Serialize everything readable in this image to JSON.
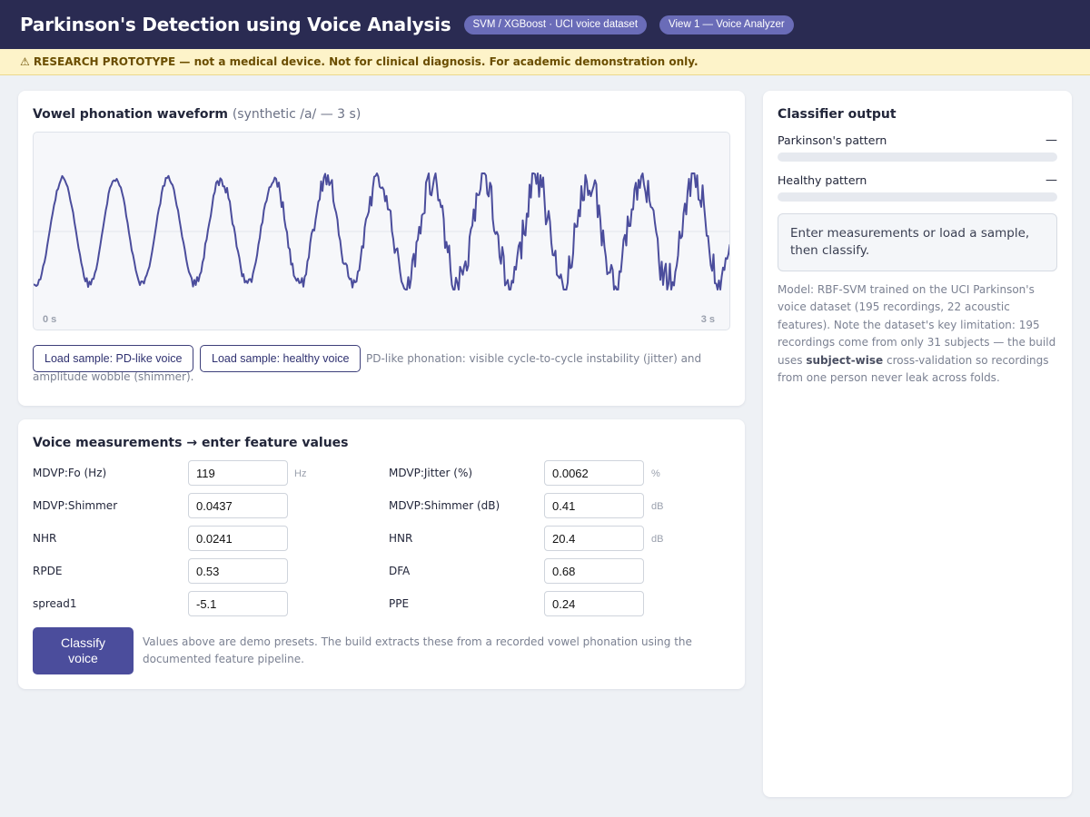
{
  "header": {
    "title": "Parkinson's Detection using Voice Analysis",
    "badges": [
      "SVM / XGBoost · UCI voice dataset",
      "View 1 — Voice Analyzer"
    ]
  },
  "disclaimer": "⚠ RESEARCH PROTOTYPE — not a medical device. Not for clinical diagnosis. For academic demonstration only.",
  "waveform": {
    "title": "Vowel phonation waveform",
    "subtitle": "(synthetic /a/ — 3 s)",
    "axis_start": "0 s",
    "axis_end": "3 s",
    "line_color": "#4b4d9c",
    "buttons": {
      "pd_sample": "Load sample: PD-like voice",
      "healthy_sample": "Load sample: healthy voice"
    },
    "note": "PD-like phonation: visible cycle-to-cycle instability (jitter) and amplitude wobble (shimmer)."
  },
  "measurements": {
    "title": "Voice measurements → enter feature values",
    "fields": [
      {
        "label": "MDVP:Fo (Hz)",
        "value": "119",
        "unit": "Hz"
      },
      {
        "label": "MDVP:Jitter (%)",
        "value": "0.0062",
        "unit": "%"
      },
      {
        "label": "MDVP:Shimmer",
        "value": "0.0437",
        "unit": ""
      },
      {
        "label": "MDVP:Shimmer (dB)",
        "value": "0.41",
        "unit": "dB"
      },
      {
        "label": "NHR",
        "value": "0.0241",
        "unit": ""
      },
      {
        "label": "HNR",
        "value": "20.4",
        "unit": "dB"
      },
      {
        "label": "RPDE",
        "value": "0.53",
        "unit": ""
      },
      {
        "label": "DFA",
        "value": "0.68",
        "unit": ""
      },
      {
        "label": "spread1",
        "value": "-5.1",
        "unit": ""
      },
      {
        "label": "PPE",
        "value": "0.24",
        "unit": ""
      }
    ],
    "classify_label": "Classify voice",
    "note": "Values above are demo presets. The build extracts these from a recorded vowel phonation using the documented feature pipeline."
  },
  "output": {
    "title": "Classifier output",
    "bars": [
      {
        "label": "Parkinson's pattern",
        "value": "—",
        "fill": 0
      },
      {
        "label": "Healthy pattern",
        "value": "—",
        "fill": 0
      }
    ],
    "result": "Enter measurements or load a sample, then classify.",
    "model_note_before": "Model: RBF-SVM trained on the UCI Parkinson's voice dataset (195 recordings, 22 acoustic features). Note the dataset's key limitation: 195 recordings come from only 31 subjects — the build uses ",
    "model_note_bold": "subject-wise",
    "model_note_after": " cross-validation so recordings from one person never leak across folds."
  }
}
